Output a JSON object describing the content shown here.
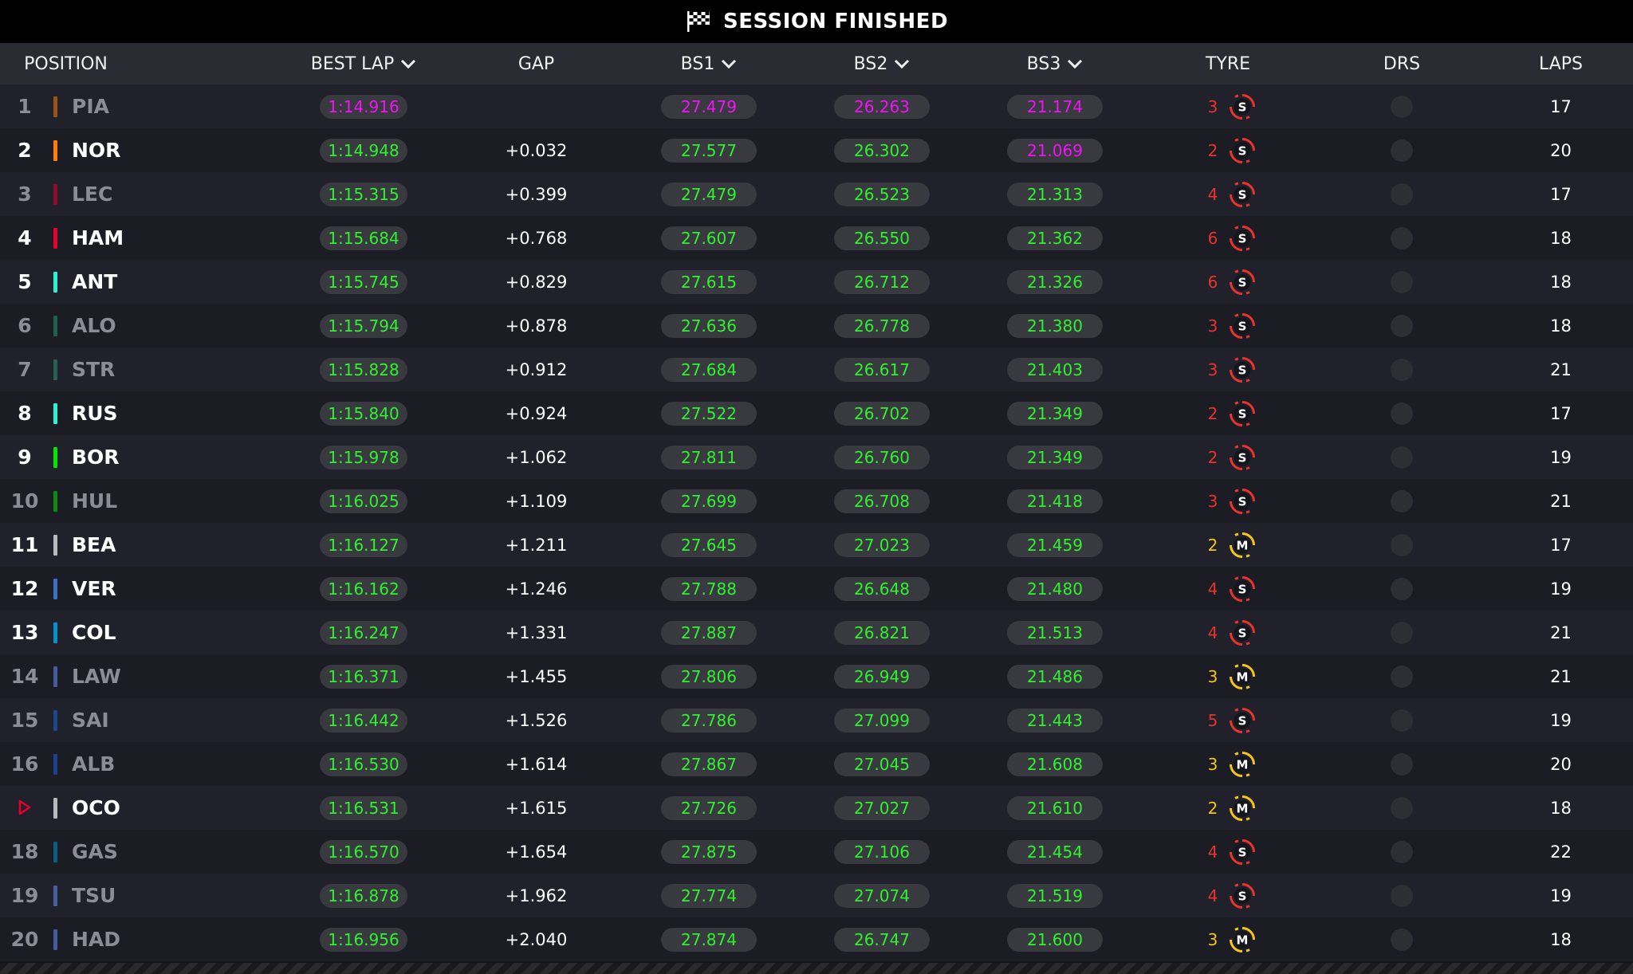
{
  "status": {
    "title": "SESSION FINISHED"
  },
  "columns": {
    "position": "POSITION",
    "best_lap": "BEST LAP",
    "gap": "GAP",
    "bs1": "BS1",
    "bs2": "BS2",
    "bs3": "BS3",
    "tyre": "TYRE",
    "drs": "DRS",
    "laps": "LAPS"
  },
  "colors": {
    "green_time": "#2ef22e",
    "purple_time": "#f013f5",
    "soft_tyre": "#e8342c",
    "medium_tyre": "#f5c518"
  },
  "rows": [
    {
      "pos": "1",
      "code": "PIA",
      "team_color": "#ff8000",
      "best_lap": "1:14.916",
      "gap": "",
      "bs1": "27.479",
      "bs2": "26.263",
      "bs3": "21.174",
      "tyre_age": "3",
      "compound": "S",
      "laps": "17",
      "dim": true,
      "purple": [
        "best_lap",
        "bs1",
        "bs2",
        "bs3"
      ]
    },
    {
      "pos": "2",
      "code": "NOR",
      "team_color": "#ff8000",
      "best_lap": "1:14.948",
      "gap": "+0.032",
      "bs1": "27.577",
      "bs2": "26.302",
      "bs3": "21.069",
      "tyre_age": "2",
      "compound": "S",
      "laps": "20",
      "dim": false,
      "purple": [
        "bs3"
      ]
    },
    {
      "pos": "3",
      "code": "LEC",
      "team_color": "#e8002d",
      "best_lap": "1:15.315",
      "gap": "+0.399",
      "bs1": "27.479",
      "bs2": "26.523",
      "bs3": "21.313",
      "tyre_age": "4",
      "compound": "S",
      "laps": "17",
      "dim": true,
      "purple": []
    },
    {
      "pos": "4",
      "code": "HAM",
      "team_color": "#e8002d",
      "best_lap": "1:15.684",
      "gap": "+0.768",
      "bs1": "27.607",
      "bs2": "26.550",
      "bs3": "21.362",
      "tyre_age": "6",
      "compound": "S",
      "laps": "18",
      "dim": false,
      "purple": []
    },
    {
      "pos": "5",
      "code": "ANT",
      "team_color": "#27f4d2",
      "best_lap": "1:15.745",
      "gap": "+0.829",
      "bs1": "27.615",
      "bs2": "26.712",
      "bs3": "21.326",
      "tyre_age": "6",
      "compound": "S",
      "laps": "18",
      "dim": false,
      "purple": []
    },
    {
      "pos": "6",
      "code": "ALO",
      "team_color": "#229971",
      "best_lap": "1:15.794",
      "gap": "+0.878",
      "bs1": "27.636",
      "bs2": "26.778",
      "bs3": "21.380",
      "tyre_age": "3",
      "compound": "S",
      "laps": "18",
      "dim": true,
      "purple": []
    },
    {
      "pos": "7",
      "code": "STR",
      "team_color": "#229971",
      "best_lap": "1:15.828",
      "gap": "+0.912",
      "bs1": "27.684",
      "bs2": "26.617",
      "bs3": "21.403",
      "tyre_age": "3",
      "compound": "S",
      "laps": "21",
      "dim": true,
      "purple": []
    },
    {
      "pos": "8",
      "code": "RUS",
      "team_color": "#27f4d2",
      "best_lap": "1:15.840",
      "gap": "+0.924",
      "bs1": "27.522",
      "bs2": "26.702",
      "bs3": "21.349",
      "tyre_age": "2",
      "compound": "S",
      "laps": "17",
      "dim": false,
      "purple": []
    },
    {
      "pos": "9",
      "code": "BOR",
      "team_color": "#00e701",
      "best_lap": "1:15.978",
      "gap": "+1.062",
      "bs1": "27.811",
      "bs2": "26.760",
      "bs3": "21.349",
      "tyre_age": "2",
      "compound": "S",
      "laps": "19",
      "dim": false,
      "purple": []
    },
    {
      "pos": "10",
      "code": "HUL",
      "team_color": "#00e701",
      "best_lap": "1:16.025",
      "gap": "+1.109",
      "bs1": "27.699",
      "bs2": "26.708",
      "bs3": "21.418",
      "tyre_age": "3",
      "compound": "S",
      "laps": "21",
      "dim": true,
      "purple": []
    },
    {
      "pos": "11",
      "code": "BEA",
      "team_color": "#b6babd",
      "best_lap": "1:16.127",
      "gap": "+1.211",
      "bs1": "27.645",
      "bs2": "27.023",
      "bs3": "21.459",
      "tyre_age": "2",
      "compound": "M",
      "laps": "17",
      "dim": false,
      "purple": []
    },
    {
      "pos": "12",
      "code": "VER",
      "team_color": "#3671c6",
      "best_lap": "1:16.162",
      "gap": "+1.246",
      "bs1": "27.788",
      "bs2": "26.648",
      "bs3": "21.480",
      "tyre_age": "4",
      "compound": "S",
      "laps": "19",
      "dim": false,
      "purple": []
    },
    {
      "pos": "13",
      "code": "COL",
      "team_color": "#0093cc",
      "best_lap": "1:16.247",
      "gap": "+1.331",
      "bs1": "27.887",
      "bs2": "26.821",
      "bs3": "21.513",
      "tyre_age": "4",
      "compound": "S",
      "laps": "21",
      "dim": false,
      "purple": []
    },
    {
      "pos": "14",
      "code": "LAW",
      "team_color": "#6692ff",
      "best_lap": "1:16.371",
      "gap": "+1.455",
      "bs1": "27.806",
      "bs2": "26.949",
      "bs3": "21.486",
      "tyre_age": "3",
      "compound": "M",
      "laps": "21",
      "dim": true,
      "purple": []
    },
    {
      "pos": "15",
      "code": "SAI",
      "team_color": "#1868db",
      "best_lap": "1:16.442",
      "gap": "+1.526",
      "bs1": "27.786",
      "bs2": "27.099",
      "bs3": "21.443",
      "tyre_age": "5",
      "compound": "S",
      "laps": "19",
      "dim": true,
      "purple": []
    },
    {
      "pos": "16",
      "code": "ALB",
      "team_color": "#1868db",
      "best_lap": "1:16.530",
      "gap": "+1.614",
      "bs1": "27.867",
      "bs2": "27.045",
      "bs3": "21.608",
      "tyre_age": "3",
      "compound": "M",
      "laps": "20",
      "dim": true,
      "purple": []
    },
    {
      "pos": "",
      "code": "OCO",
      "team_color": "#b6babd",
      "best_lap": "1:16.531",
      "gap": "+1.615",
      "bs1": "27.726",
      "bs2": "27.027",
      "bs3": "21.610",
      "tyre_age": "2",
      "compound": "M",
      "laps": "18",
      "dim": false,
      "purple": [],
      "pos_icon": "play-triangle-icon"
    },
    {
      "pos": "18",
      "code": "GAS",
      "team_color": "#0093cc",
      "best_lap": "1:16.570",
      "gap": "+1.654",
      "bs1": "27.875",
      "bs2": "27.106",
      "bs3": "21.454",
      "tyre_age": "4",
      "compound": "S",
      "laps": "22",
      "dim": true,
      "purple": []
    },
    {
      "pos": "19",
      "code": "TSU",
      "team_color": "#6692ff",
      "best_lap": "1:16.878",
      "gap": "+1.962",
      "bs1": "27.774",
      "bs2": "27.074",
      "bs3": "21.519",
      "tyre_age": "4",
      "compound": "S",
      "laps": "19",
      "dim": true,
      "purple": []
    },
    {
      "pos": "20",
      "code": "HAD",
      "team_color": "#6692ff",
      "best_lap": "1:16.956",
      "gap": "+2.040",
      "bs1": "27.874",
      "bs2": "26.747",
      "bs3": "21.600",
      "tyre_age": "3",
      "compound": "M",
      "laps": "18",
      "dim": true,
      "purple": []
    }
  ]
}
